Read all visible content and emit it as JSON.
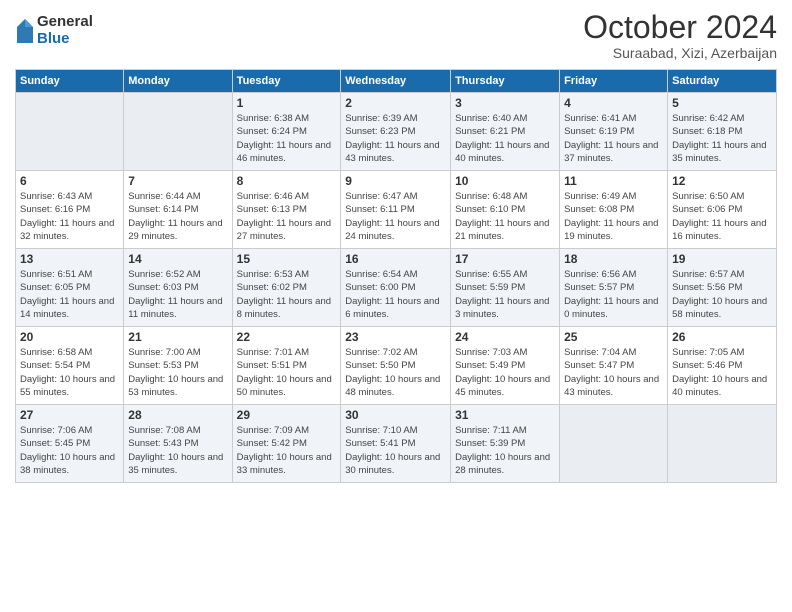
{
  "logo": {
    "general": "General",
    "blue": "Blue"
  },
  "header": {
    "month": "October 2024",
    "location": "Suraabad, Xizi, Azerbaijan"
  },
  "weekdays": [
    "Sunday",
    "Monday",
    "Tuesday",
    "Wednesday",
    "Thursday",
    "Friday",
    "Saturday"
  ],
  "weeks": [
    [
      {
        "day": "",
        "sunrise": "",
        "sunset": "",
        "daylight": ""
      },
      {
        "day": "",
        "sunrise": "",
        "sunset": "",
        "daylight": ""
      },
      {
        "day": "1",
        "sunrise": "Sunrise: 6:38 AM",
        "sunset": "Sunset: 6:24 PM",
        "daylight": "Daylight: 11 hours and 46 minutes."
      },
      {
        "day": "2",
        "sunrise": "Sunrise: 6:39 AM",
        "sunset": "Sunset: 6:23 PM",
        "daylight": "Daylight: 11 hours and 43 minutes."
      },
      {
        "day": "3",
        "sunrise": "Sunrise: 6:40 AM",
        "sunset": "Sunset: 6:21 PM",
        "daylight": "Daylight: 11 hours and 40 minutes."
      },
      {
        "day": "4",
        "sunrise": "Sunrise: 6:41 AM",
        "sunset": "Sunset: 6:19 PM",
        "daylight": "Daylight: 11 hours and 37 minutes."
      },
      {
        "day": "5",
        "sunrise": "Sunrise: 6:42 AM",
        "sunset": "Sunset: 6:18 PM",
        "daylight": "Daylight: 11 hours and 35 minutes."
      }
    ],
    [
      {
        "day": "6",
        "sunrise": "Sunrise: 6:43 AM",
        "sunset": "Sunset: 6:16 PM",
        "daylight": "Daylight: 11 hours and 32 minutes."
      },
      {
        "day": "7",
        "sunrise": "Sunrise: 6:44 AM",
        "sunset": "Sunset: 6:14 PM",
        "daylight": "Daylight: 11 hours and 29 minutes."
      },
      {
        "day": "8",
        "sunrise": "Sunrise: 6:46 AM",
        "sunset": "Sunset: 6:13 PM",
        "daylight": "Daylight: 11 hours and 27 minutes."
      },
      {
        "day": "9",
        "sunrise": "Sunrise: 6:47 AM",
        "sunset": "Sunset: 6:11 PM",
        "daylight": "Daylight: 11 hours and 24 minutes."
      },
      {
        "day": "10",
        "sunrise": "Sunrise: 6:48 AM",
        "sunset": "Sunset: 6:10 PM",
        "daylight": "Daylight: 11 hours and 21 minutes."
      },
      {
        "day": "11",
        "sunrise": "Sunrise: 6:49 AM",
        "sunset": "Sunset: 6:08 PM",
        "daylight": "Daylight: 11 hours and 19 minutes."
      },
      {
        "day": "12",
        "sunrise": "Sunrise: 6:50 AM",
        "sunset": "Sunset: 6:06 PM",
        "daylight": "Daylight: 11 hours and 16 minutes."
      }
    ],
    [
      {
        "day": "13",
        "sunrise": "Sunrise: 6:51 AM",
        "sunset": "Sunset: 6:05 PM",
        "daylight": "Daylight: 11 hours and 14 minutes."
      },
      {
        "day": "14",
        "sunrise": "Sunrise: 6:52 AM",
        "sunset": "Sunset: 6:03 PM",
        "daylight": "Daylight: 11 hours and 11 minutes."
      },
      {
        "day": "15",
        "sunrise": "Sunrise: 6:53 AM",
        "sunset": "Sunset: 6:02 PM",
        "daylight": "Daylight: 11 hours and 8 minutes."
      },
      {
        "day": "16",
        "sunrise": "Sunrise: 6:54 AM",
        "sunset": "Sunset: 6:00 PM",
        "daylight": "Daylight: 11 hours and 6 minutes."
      },
      {
        "day": "17",
        "sunrise": "Sunrise: 6:55 AM",
        "sunset": "Sunset: 5:59 PM",
        "daylight": "Daylight: 11 hours and 3 minutes."
      },
      {
        "day": "18",
        "sunrise": "Sunrise: 6:56 AM",
        "sunset": "Sunset: 5:57 PM",
        "daylight": "Daylight: 11 hours and 0 minutes."
      },
      {
        "day": "19",
        "sunrise": "Sunrise: 6:57 AM",
        "sunset": "Sunset: 5:56 PM",
        "daylight": "Daylight: 10 hours and 58 minutes."
      }
    ],
    [
      {
        "day": "20",
        "sunrise": "Sunrise: 6:58 AM",
        "sunset": "Sunset: 5:54 PM",
        "daylight": "Daylight: 10 hours and 55 minutes."
      },
      {
        "day": "21",
        "sunrise": "Sunrise: 7:00 AM",
        "sunset": "Sunset: 5:53 PM",
        "daylight": "Daylight: 10 hours and 53 minutes."
      },
      {
        "day": "22",
        "sunrise": "Sunrise: 7:01 AM",
        "sunset": "Sunset: 5:51 PM",
        "daylight": "Daylight: 10 hours and 50 minutes."
      },
      {
        "day": "23",
        "sunrise": "Sunrise: 7:02 AM",
        "sunset": "Sunset: 5:50 PM",
        "daylight": "Daylight: 10 hours and 48 minutes."
      },
      {
        "day": "24",
        "sunrise": "Sunrise: 7:03 AM",
        "sunset": "Sunset: 5:49 PM",
        "daylight": "Daylight: 10 hours and 45 minutes."
      },
      {
        "day": "25",
        "sunrise": "Sunrise: 7:04 AM",
        "sunset": "Sunset: 5:47 PM",
        "daylight": "Daylight: 10 hours and 43 minutes."
      },
      {
        "day": "26",
        "sunrise": "Sunrise: 7:05 AM",
        "sunset": "Sunset: 5:46 PM",
        "daylight": "Daylight: 10 hours and 40 minutes."
      }
    ],
    [
      {
        "day": "27",
        "sunrise": "Sunrise: 7:06 AM",
        "sunset": "Sunset: 5:45 PM",
        "daylight": "Daylight: 10 hours and 38 minutes."
      },
      {
        "day": "28",
        "sunrise": "Sunrise: 7:08 AM",
        "sunset": "Sunset: 5:43 PM",
        "daylight": "Daylight: 10 hours and 35 minutes."
      },
      {
        "day": "29",
        "sunrise": "Sunrise: 7:09 AM",
        "sunset": "Sunset: 5:42 PM",
        "daylight": "Daylight: 10 hours and 33 minutes."
      },
      {
        "day": "30",
        "sunrise": "Sunrise: 7:10 AM",
        "sunset": "Sunset: 5:41 PM",
        "daylight": "Daylight: 10 hours and 30 minutes."
      },
      {
        "day": "31",
        "sunrise": "Sunrise: 7:11 AM",
        "sunset": "Sunset: 5:39 PM",
        "daylight": "Daylight: 10 hours and 28 minutes."
      },
      {
        "day": "",
        "sunrise": "",
        "sunset": "",
        "daylight": ""
      },
      {
        "day": "",
        "sunrise": "",
        "sunset": "",
        "daylight": ""
      }
    ]
  ]
}
